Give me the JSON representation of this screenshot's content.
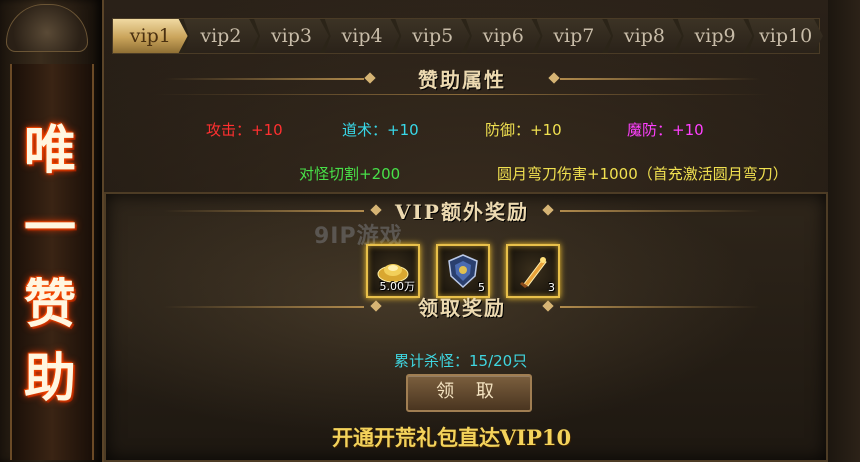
{
  "sidebar": {
    "title_chars": [
      "唯",
      "一",
      "赞",
      "助"
    ]
  },
  "tabs": [
    "vip1",
    "vip2",
    "vip3",
    "vip4",
    "vip5",
    "vip6",
    "vip7",
    "vip8",
    "vip9",
    "vip10"
  ],
  "active_tab": "vip1",
  "sponsor_attrs": {
    "title": "赞助属性",
    "stats": [
      {
        "text": "攻击：+10",
        "color": "#ff3030"
      },
      {
        "text": "道术：+10",
        "color": "#38d8e8"
      },
      {
        "text": "防御：+10",
        "color": "#f0e050"
      },
      {
        "text": "魔防：+10",
        "color": "#ff40ff"
      }
    ],
    "extra1": {
      "text": "对怪切割+200",
      "color": "#48e048"
    },
    "extra2": {
      "text": "圆月弯刀伤害+1000（首充激活圆月弯刀）",
      "color": "#f0e050"
    }
  },
  "vip_rewards": {
    "title": "VIP额外奖励",
    "watermark": "9IP游戏",
    "items": [
      {
        "icon": "gold-ingot-icon",
        "count": "5.00万"
      },
      {
        "icon": "armor-shield-icon",
        "count": "5"
      },
      {
        "icon": "sword-scroll-icon",
        "count": "3"
      }
    ]
  },
  "claim_section": {
    "title": "领取奖励",
    "kill_text": "累计杀怪：15/20只",
    "claim_button": "领 取",
    "promo_text": "开通开荒礼包直达VIP10"
  }
}
